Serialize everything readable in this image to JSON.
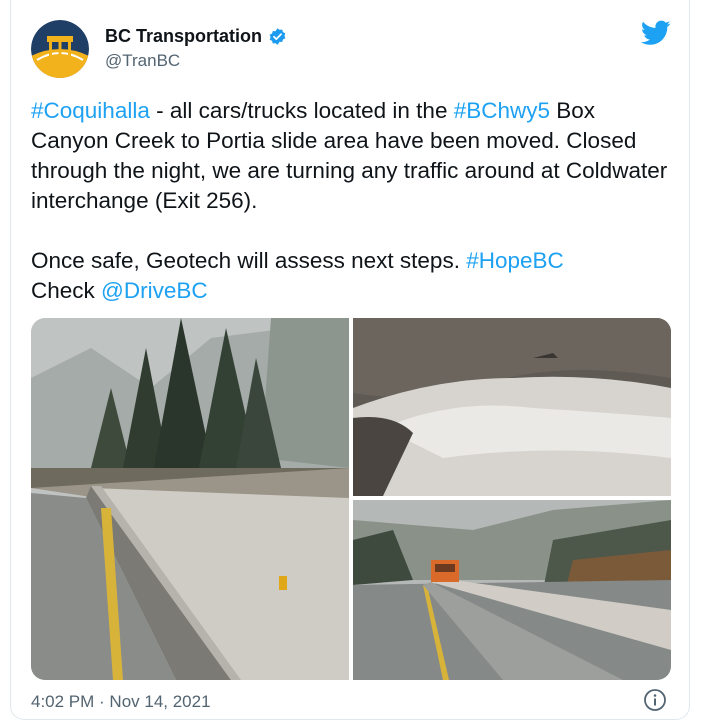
{
  "author": {
    "name": "BC Transportation",
    "handle": "@TranBC"
  },
  "tweet": {
    "line1_tag1": "#Coquihalla",
    "line1_text1": " - all cars/trucks located in the ",
    "line1_tag2": "#BChwy5",
    "line1_text2": " Box Canyon Creek to Portia slide area have been moved. Closed through the night, we are turning any traffic around at Coldwater interchange (Exit 256).",
    "line2_text1": "Once safe, Geotech will assess next steps. ",
    "line2_tag1": "#HopeBC",
    "line3_text1": "Check ",
    "line3_mention": "@DriveBC"
  },
  "timestamp": "4:02 PM · Nov 14, 2021",
  "colors": {
    "link": "#1da1f2",
    "verified": "#1d9bf0",
    "muted": "#536471"
  },
  "icons": [
    "verified-badge-icon",
    "twitter-bird-icon",
    "info-icon"
  ]
}
